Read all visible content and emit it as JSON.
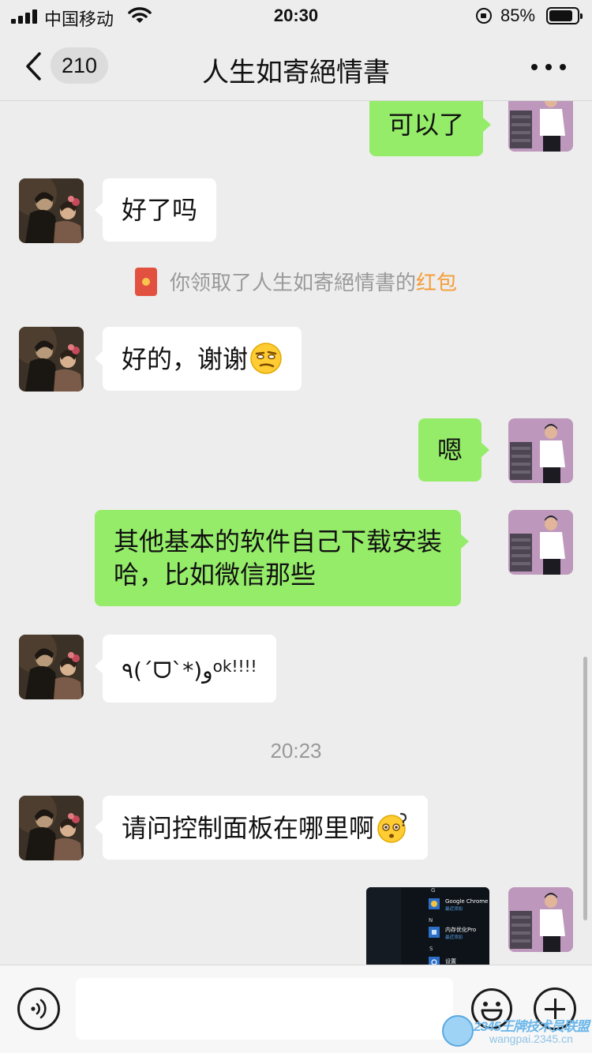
{
  "status_bar": {
    "carrier": "中国移动",
    "time": "20:30",
    "battery_percent": "85%",
    "battery_level": 0.85
  },
  "nav": {
    "unread_count": "210",
    "title": "人生如寄絕情書"
  },
  "messages": [
    {
      "side": "out",
      "text": "可以了"
    },
    {
      "side": "in",
      "text": "好了吗"
    },
    {
      "side": "system",
      "prefix": "你领取了人生如寄絕情書的",
      "link": "红包"
    },
    {
      "side": "in",
      "text": "好的，谢谢",
      "emoji": "smirk-emoji"
    },
    {
      "side": "out",
      "text": "嗯"
    },
    {
      "side": "out",
      "lines": [
        "其他基本的软件自己下载安装",
        "哈，比如微信那些"
      ]
    },
    {
      "side": "in",
      "text": "٩(ˊᗜˋ*)و",
      "sup": "ok!!!!"
    },
    {
      "side": "time",
      "text": "20:23"
    },
    {
      "side": "in",
      "text": "请问控制面板在哪里啊",
      "emoji": "confused-emoji"
    },
    {
      "side": "out",
      "type": "image",
      "image_lines": {
        "g": "G",
        "chrome": "Google Chrome",
        "chrome_sub": "最近添加",
        "n": "N",
        "app2": "内存优化Pro",
        "app2_sub": "最近添加",
        "s": "S",
        "s_item": "设置"
      }
    }
  ],
  "input": {
    "placeholder": ""
  },
  "watermark": {
    "name": "2345王牌技术员联盟",
    "url": "wangpai.2345.cn"
  },
  "colors": {
    "outgoing_bubble": "#95ec69",
    "incoming_bubble": "#ffffff",
    "background": "#ededed",
    "red_packet_link": "#f59d38"
  }
}
